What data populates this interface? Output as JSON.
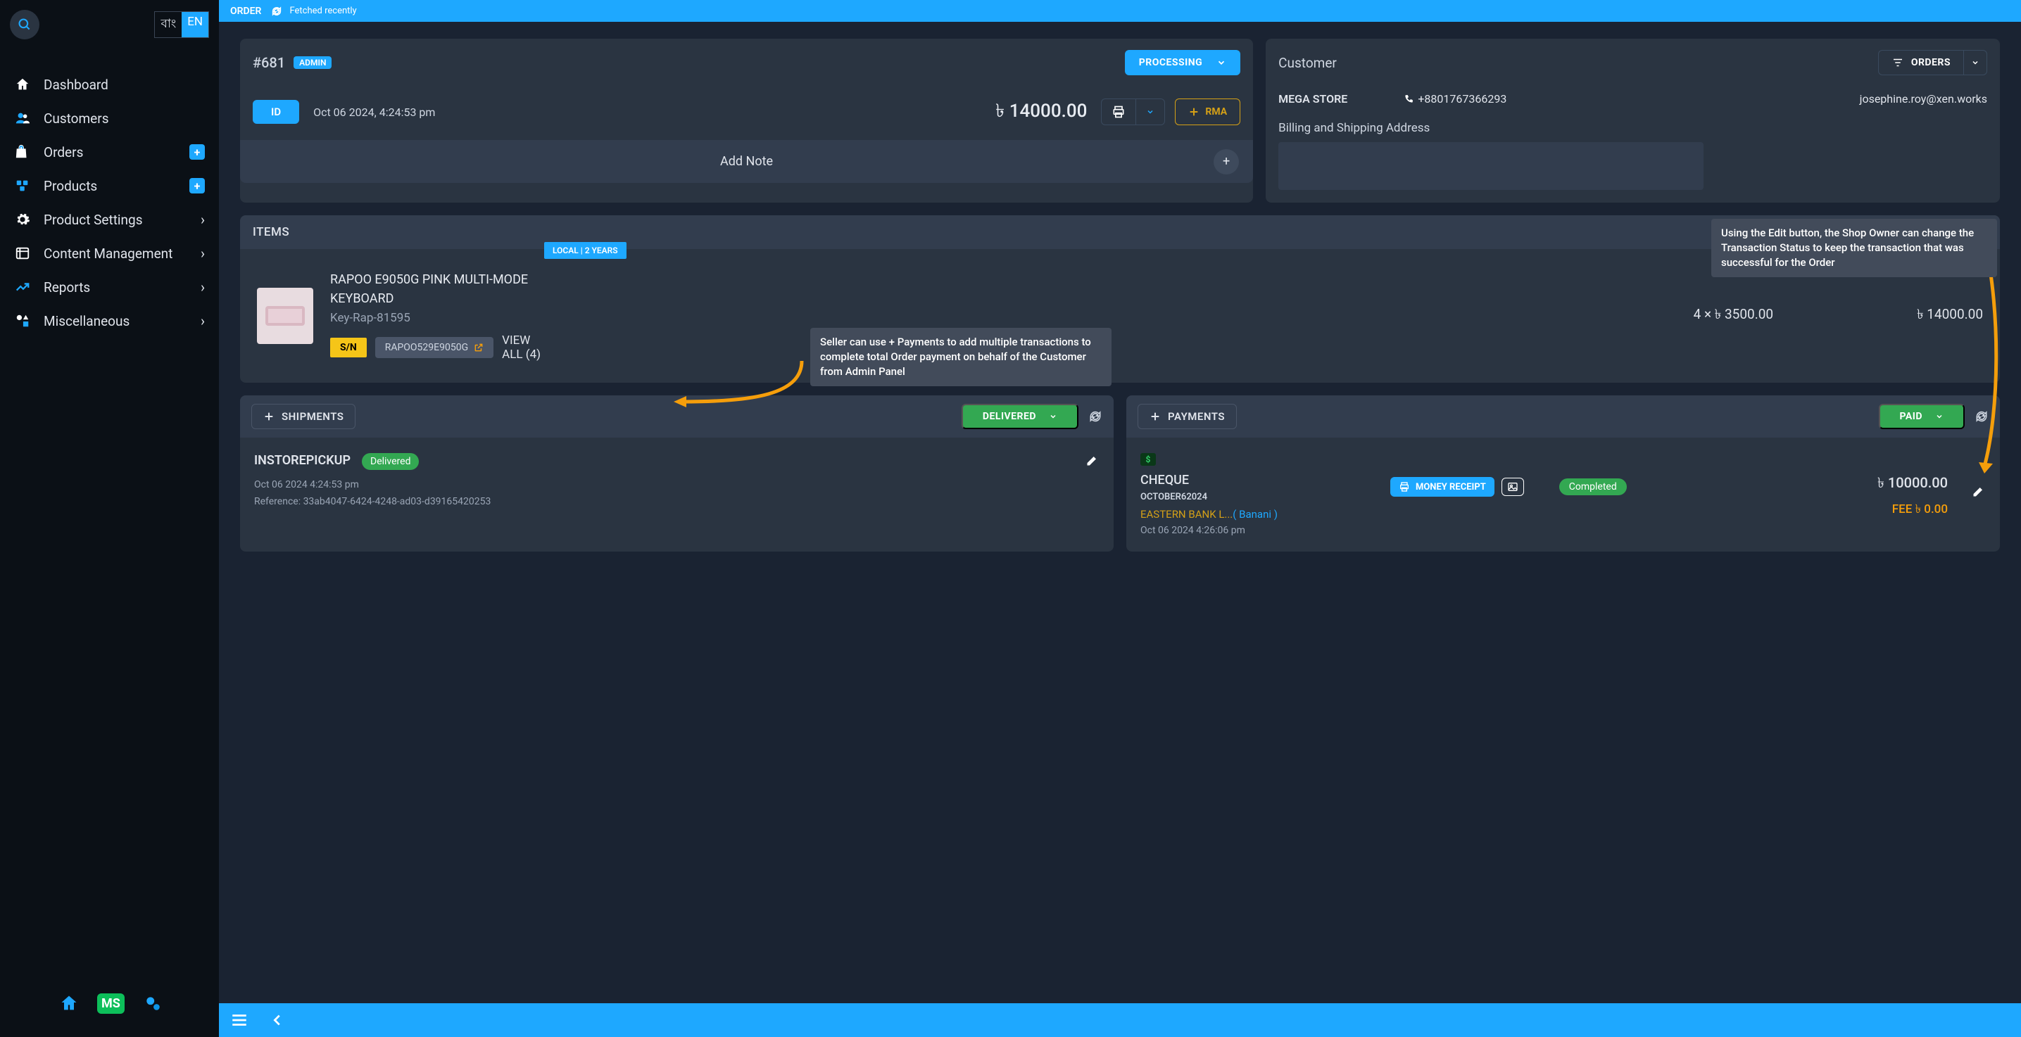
{
  "topbar": {
    "title": "ORDER",
    "status": "Fetched recently"
  },
  "lang": {
    "bn": "বাং",
    "en": "EN"
  },
  "nav": {
    "dashboard": "Dashboard",
    "customers": "Customers",
    "orders": "Orders",
    "products": "Products",
    "product_settings": "Product Settings",
    "content_management": "Content Management",
    "reports": "Reports",
    "miscellaneous": "Miscellaneous"
  },
  "ms": "MS",
  "order": {
    "number": "#681",
    "badge": "ADMIN",
    "status": "PROCESSING",
    "id_label": "ID",
    "date": "Oct 06 2024, 4:24:53 pm",
    "total": "৳ 14000.00",
    "rma": "RMA",
    "add_note": "Add Note"
  },
  "customer": {
    "title": "Customer",
    "orders_btn": "ORDERS",
    "name": "MEGA STORE",
    "phone": "+8801767366293",
    "email": "josephine.roy@xen.works",
    "addr_label": "Billing and Shipping Address"
  },
  "items": {
    "header": "ITEMS",
    "name": "RAPOO E9050G PINK MULTI-MODE KEYBOARD",
    "sku": "Key-Rap-81595",
    "warranty": "LOCAL | 2 YEARS",
    "sn": "S/N",
    "serial": "RAPOO529E9050G",
    "view_all": "VIEW ALL (4)",
    "qty": "4 × ৳ 3500.00",
    "line_total": "৳ 14000.00"
  },
  "shipments": {
    "add": "SHIPMENTS",
    "status": "DELIVERED",
    "method": "INSTOREPICKUP",
    "badge": "Delivered",
    "date": "Oct 06 2024 4:24:53 pm",
    "ref": "Reference: 33ab4047-6424-4248-ad03-d39165420253"
  },
  "payments": {
    "add": "PAYMENTS",
    "status": "PAID",
    "method": "CHEQUE",
    "ref": "OCTOBER62024",
    "bank": "EASTERN BANK L...",
    "branch": "( Banani )",
    "date": "Oct 06 2024 4:26:06 pm",
    "receipt": "MONEY RECEIPT",
    "completed": "Completed",
    "amount": "৳ 10000.00",
    "fee": "FEE ৳ 0.00"
  },
  "tips": {
    "edit": "Using the Edit button, the Shop Owner can change the Transaction Status to keep the transaction that was successful for the Order",
    "pay": "Seller can use + Payments to add multiple transactions to complete total Order payment on behalf of the Customer from Admin Panel"
  }
}
